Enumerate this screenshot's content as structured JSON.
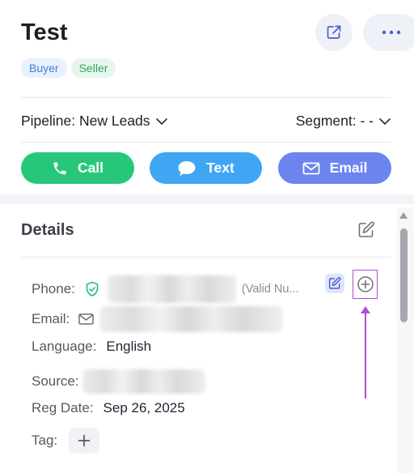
{
  "header": {
    "title": "Test",
    "tags": [
      "Buyer",
      "Seller"
    ],
    "icons": {
      "share": "share-icon",
      "more": "more-dots-icon"
    }
  },
  "filters": {
    "pipeline": "Pipeline: New Leads",
    "segment": "Segment: - -"
  },
  "actions": {
    "call": "Call",
    "text": "Text",
    "email": "Email"
  },
  "details": {
    "title": "Details",
    "phone_label": "Phone:",
    "phone_hint": "(Valid Nu...",
    "email_label": "Email:",
    "language_label": "Language:",
    "language_value": "English",
    "source_label": "Source:",
    "reg_date_label": "Reg Date:",
    "reg_date_value": "Sep 26, 2025",
    "tag_label": "Tag:"
  },
  "colors": {
    "call": "#27c77a",
    "text": "#3fa6f4",
    "email": "#6b84f0",
    "annotation": "#b64ad8",
    "buyer_tag": "#3b7fd9",
    "seller_tag": "#33a860"
  }
}
